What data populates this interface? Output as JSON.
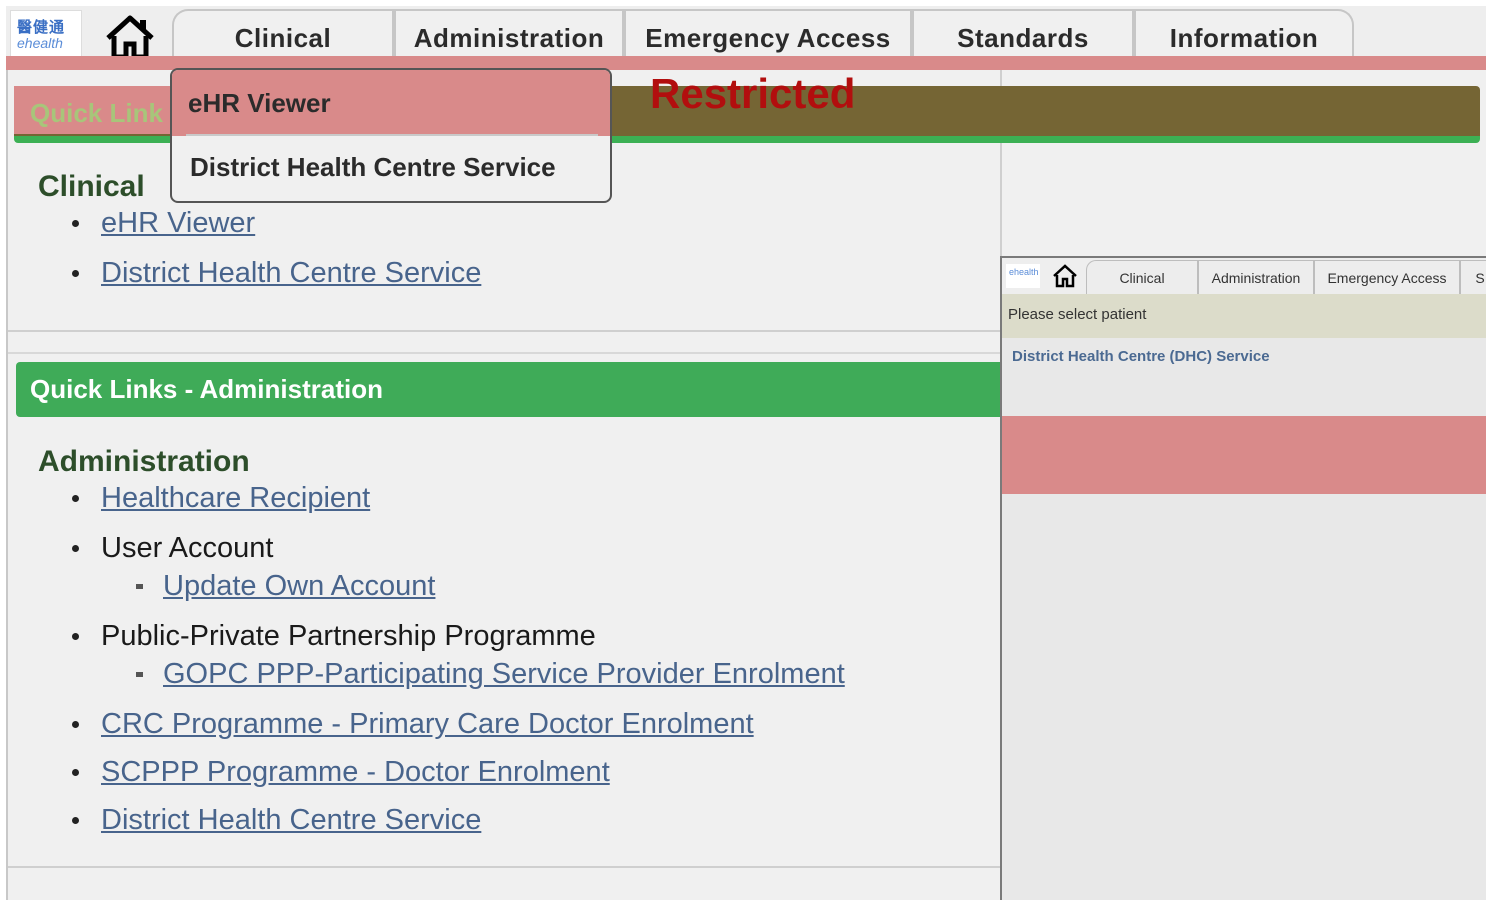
{
  "logo": {
    "cn_text": "醫健通",
    "en_text": "ehealth"
  },
  "nav": {
    "tabs": [
      {
        "label": "Clinical"
      },
      {
        "label": "Administration"
      },
      {
        "label": "Emergency Access"
      },
      {
        "label": "Standards"
      },
      {
        "label": "Information"
      }
    ]
  },
  "dropdown": {
    "items": [
      {
        "label": "eHR Viewer"
      },
      {
        "label": "District Health Centre Service"
      }
    ]
  },
  "restricted_label": "Restricted",
  "clinical_panel": {
    "header": "Quick Links - Clinical",
    "header_visible": "Quick Link",
    "section_title": "Clinical",
    "links": [
      "eHR Viewer",
      "District Health Centre Service"
    ]
  },
  "admin_panel": {
    "header": "Quick Links - Administration",
    "section_title": "Administration",
    "items": {
      "healthcare_recipient": "Healthcare Recipient",
      "user_account": "User Account",
      "update_own_account": "Update Own Account",
      "ppp_programme": "Public-Private Partnership Programme",
      "gopc_ppp": "GOPC PPP-Participating Service Provider Enrolment",
      "crc_programme": "CRC Programme - Primary Care Doctor Enrolment",
      "scppp_programme": "SCPPP Programme - Doctor Enrolment",
      "dhc_service": "District Health Centre Service"
    }
  },
  "inset": {
    "tabs": [
      "Clinical",
      "Administration",
      "Emergency Access",
      "S"
    ],
    "subheader": "Please select patient",
    "link": "District Health Centre (DHC) Service"
  },
  "colors": {
    "restricted_overlay": "#d98a8a",
    "restricted_text": "#b20e0e",
    "quick_links_green": "#3fab58",
    "link_blue": "#48648c"
  }
}
